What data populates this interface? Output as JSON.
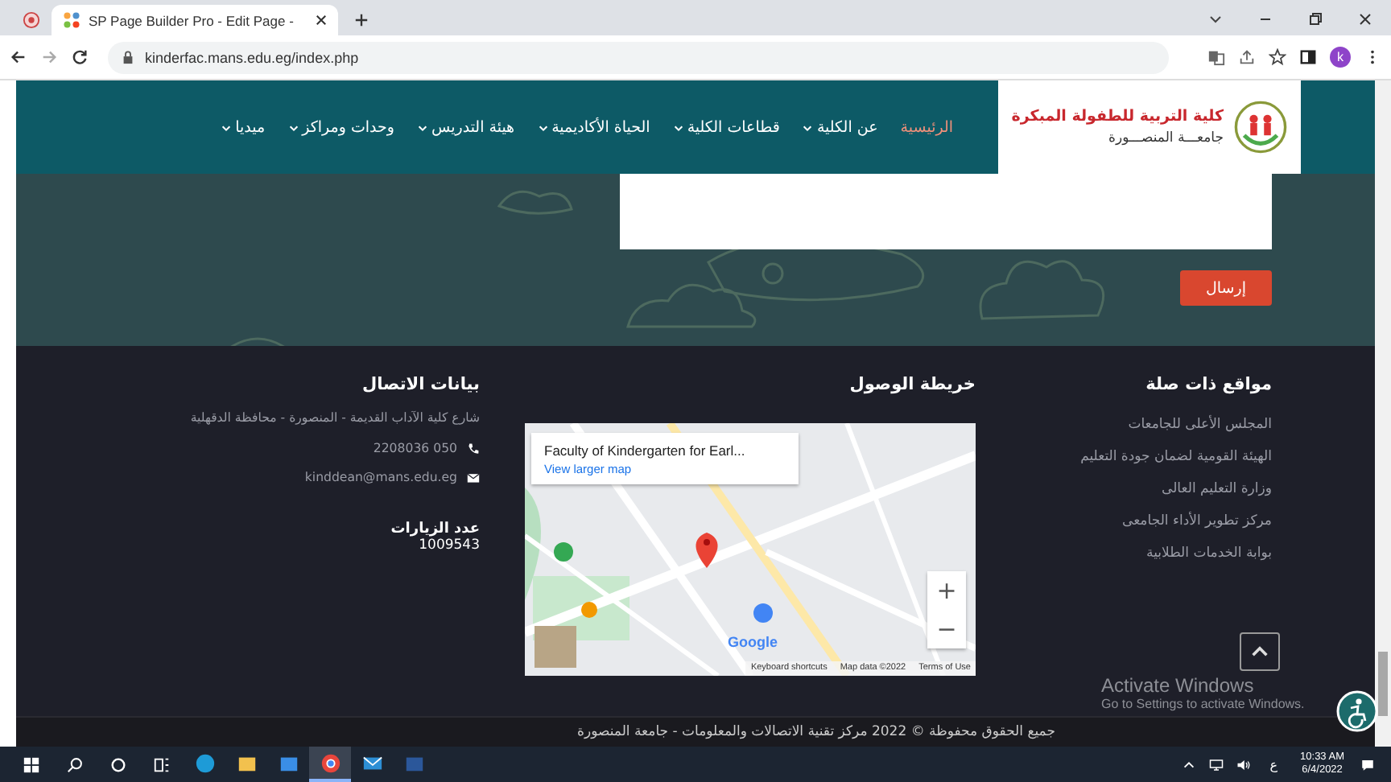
{
  "browser": {
    "tabs": [
      {
        "kind": "pinned",
        "selected": false
      },
      {
        "kind": "page",
        "title": "SP Page Builder Pro - Edit Page -",
        "selected": true
      }
    ],
    "url": "kinderfac.mans.edu.eg/index.php",
    "profile_initial": "k"
  },
  "site": {
    "logo": {
      "title": "كلية التربية للطفولة المبكرة",
      "subtitle": "جامعـــة المنصـــورة"
    },
    "nav": [
      {
        "label": "الرئيسية",
        "selected": true,
        "dropdown": false
      },
      {
        "label": "عن الكلية",
        "selected": false,
        "dropdown": true
      },
      {
        "label": "قطاعات الكلية",
        "selected": false,
        "dropdown": true
      },
      {
        "label": "الحياة الأكاديمية",
        "selected": false,
        "dropdown": true
      },
      {
        "label": "هيئة التدريس",
        "selected": false,
        "dropdown": true
      },
      {
        "label": "وحدات ومراكز",
        "selected": false,
        "dropdown": true
      },
      {
        "label": "ميديا",
        "selected": false,
        "dropdown": true
      }
    ],
    "submit_button": "إرسال"
  },
  "footer": {
    "links_section": {
      "title": "مواقع ذات صلة",
      "links": [
        "المجلس الأعلى للجامعات",
        "الهيئة القومية لضمان جودة التعليم",
        "وزارة التعليم العالى",
        "مركز تطوير الأداء الجامعى",
        "بوابة الخدمات الطلابية"
      ]
    },
    "map_section": {
      "title": "خريطة الوصول",
      "map": {
        "place": "Faculty of Kindergarten for Earl...",
        "larger_map_link": "View larger map",
        "zoom_in": "+",
        "zoom_out": "−",
        "logo": "Google",
        "shortcuts_link": "Keyboard shortcuts",
        "map_data": "Map data ©2022",
        "terms_link": "Terms of Use"
      }
    },
    "contact_section": {
      "title": "بيانات الاتصال",
      "address": "شارع كلية الآداب القديمة - المنصورة - محافظة الدقهلية",
      "phone": "050 2208036",
      "email": "kinddean@mans.edu.eg",
      "visits_label": "عدد الزيارات",
      "visits": "1009543"
    },
    "copyright": "جميع الحقوق محفوظة © 2022 مركز تقنية الاتصالات والمعلومات - جامعة المنصورة"
  },
  "windows_notice": {
    "title": "Activate Windows",
    "hint": "Go to Settings to activate Windows."
  },
  "taskbar": {
    "apps": [
      {
        "kind": "edge",
        "selected": false
      },
      {
        "kind": "explorer",
        "selected": false
      },
      {
        "kind": "store",
        "selected": false
      },
      {
        "kind": "chrome",
        "selected": true
      },
      {
        "kind": "mail",
        "selected": false
      },
      {
        "kind": "word",
        "selected": false
      }
    ],
    "language": "ع",
    "time": "10:33 AM",
    "date": "6/4/2022"
  }
}
